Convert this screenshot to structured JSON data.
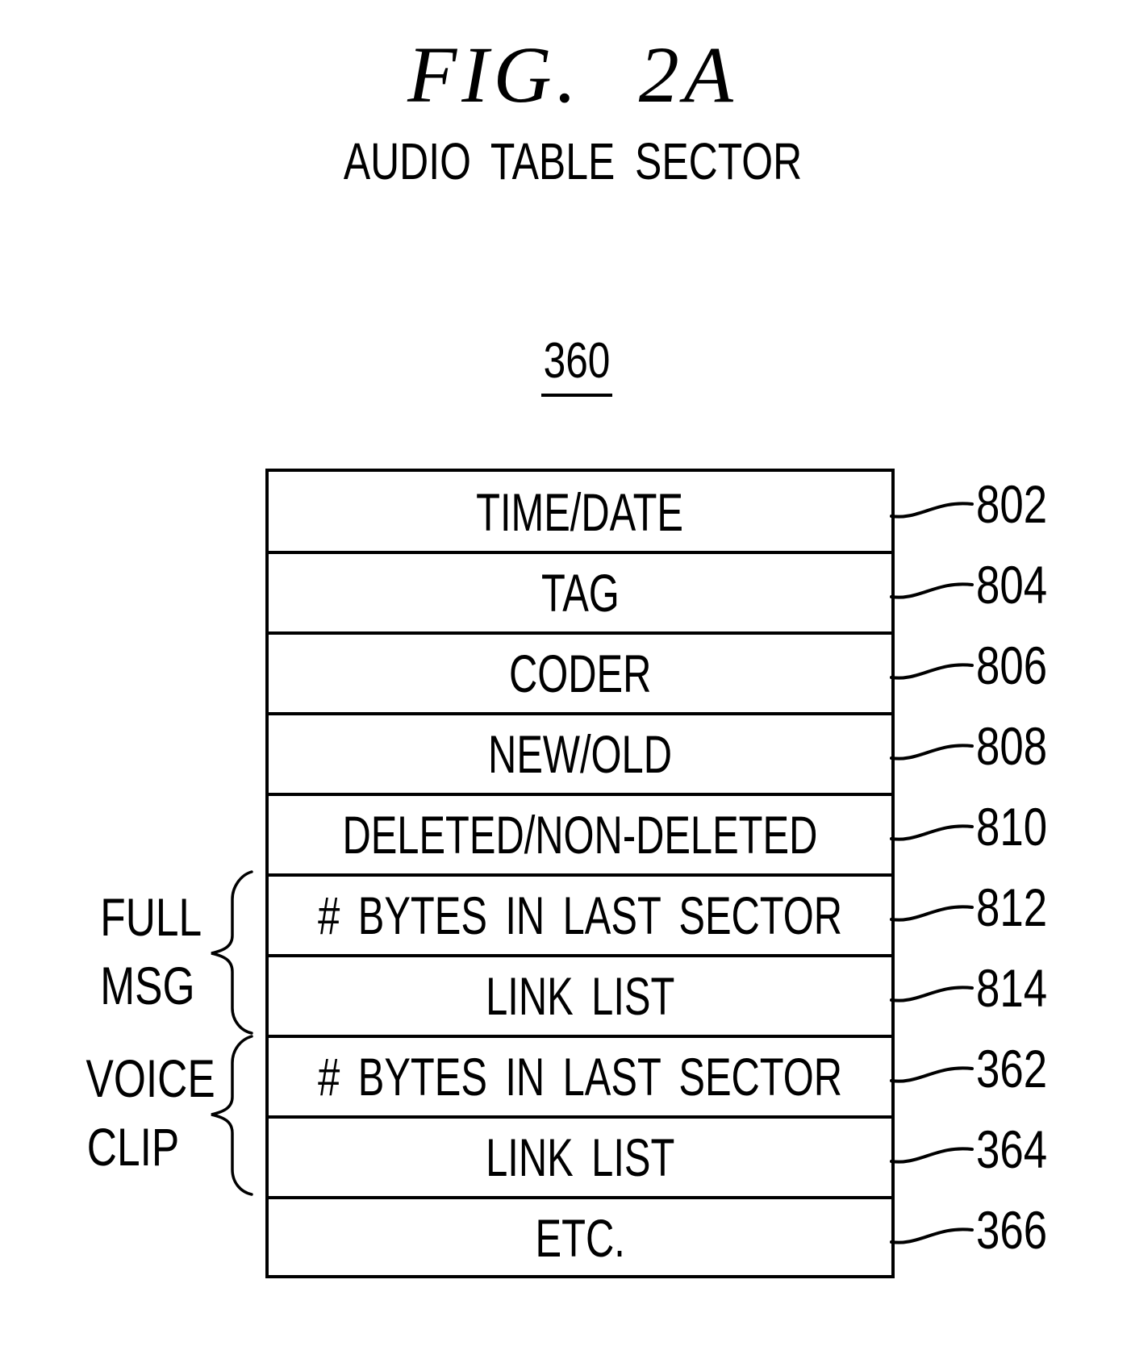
{
  "figure": {
    "title": "FIG. 2A",
    "subtitle": "AUDIO TABLE SECTOR",
    "reference_number": "360"
  },
  "table": {
    "rows": [
      {
        "label": "TIME/DATE",
        "ref": "802"
      },
      {
        "label": "TAG",
        "ref": "804"
      },
      {
        "label": "CODER",
        "ref": "806"
      },
      {
        "label": "NEW/OLD",
        "ref": "808"
      },
      {
        "label": "DELETED/NON-DELETED",
        "ref": "810"
      },
      {
        "label": "# BYTES IN LAST SECTOR",
        "ref": "812"
      },
      {
        "label": "LINK LIST",
        "ref": "814"
      },
      {
        "label": "# BYTES IN LAST SECTOR",
        "ref": "362"
      },
      {
        "label": "LINK LIST",
        "ref": "364"
      },
      {
        "label": "ETC.",
        "ref": "366"
      }
    ]
  },
  "groups": [
    {
      "line1": "FULL",
      "line2": "MSG",
      "rows": [
        6,
        7
      ]
    },
    {
      "line1": "VOICE",
      "line2": "CLIP",
      "rows": [
        8,
        9
      ]
    }
  ]
}
